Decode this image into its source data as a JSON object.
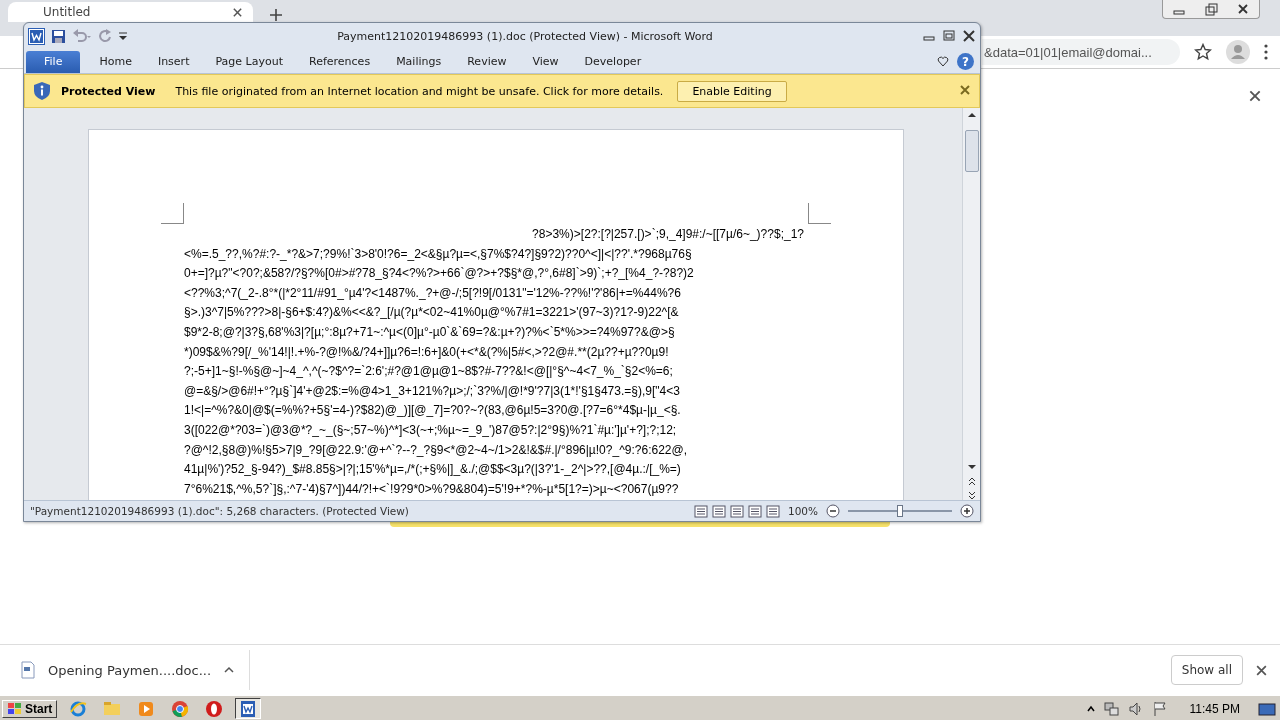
{
  "browser": {
    "tab": {
      "title": "Untitled"
    },
    "address": "&data=01|01|email@domai..."
  },
  "word": {
    "title": "Payment12102019486993 (1).doc (Protected View)  -  Microsoft Word",
    "ribbon_tabs": [
      {
        "label": "File",
        "selected": true
      },
      {
        "label": "Home",
        "selected": false
      },
      {
        "label": "Insert",
        "selected": false
      },
      {
        "label": "Page Layout",
        "selected": false
      },
      {
        "label": "References",
        "selected": false
      },
      {
        "label": "Mailings",
        "selected": false
      },
      {
        "label": "Review",
        "selected": false
      },
      {
        "label": "View",
        "selected": false
      },
      {
        "label": "Developer",
        "selected": false
      }
    ],
    "help": "?",
    "protected_view": {
      "title": "Protected View",
      "message": "This file originated from an Internet location and might be unsafe. Click for more details.",
      "button": "Enable Editing"
    },
    "document": {
      "lines": [
        "?8>3%)>[2?:[?|257.[)>`;9,_4]9#:/~[[7µ/6~_)??$;_1?",
        "<%=.5_??,%?#:?-_*?&>7;?9%!`3>8'0!?6=_2<&§µ?µ=<,§7%$?4?]§9?2)??0^<]|<|??'.*?968µ76§",
        "0+=]?µ?\"<?0?;&58?/?§?%[0#>#?78_§?4<?%?>+66`@?>+?$§*@,?°,6#8]`>9)`;+?_[%4_?-?8?)2",
        "<??%3;^7(_2-.8°*(|*2°11/#91_°µ4'?<1487%._?+@-/;5[?!9[/0131\"='12%-??%!'?'86|+=%44%?6",
        "§>.)3^7|5%???>8|-§6+$:4?)&%<<&?_[/µ(?µ*<02~41%0µ@°%7#1=3221>'(97~3)?1?-9)22^[&",
        "$9*2-8;@?|3?§,68'%3|?[µ;°:8µ?+71~:^µ<(0]µ°-µ0`&`69=?&:µ+?)?%<`5*%>>=?4%97?&@>§",
        "*)09$&%?9[/_%'14!|!.+%-?@!%&/?4+]]µ?6=!:6+]&0(+<*&(?%|5#<,>?2@#.**(2µ??+µ??0µ9!",
        "?;-5+]1~§!-%§@~]~4_^,^(~?$^?=`2:6';#?@1@µ@1~8$?#-7??&!<@[|°§^~4<7_%_`§2<%=6;",
        "@=&§/>@6#!+°?µ§`]4'+@2$:=%@4>1_3+121%?µ>;/;`3?%/|@!*9'?7|3(1*!'§1§473.=§),9[\"4<3",
        "1!<|=^%?&0|@$(=%%?+5§'=4-)?$82)@_)][@_7]=?0?~?(83,@6µ!5=3?0@.[?7=6°*4$µ-|µ_<§.",
        "3([022@*?03=`)@3@*?_~_(§~;57~%)^*]<3(~+;%µ~=_9_')87@5?:|2°9§)%?1`#µ:']µ'+?];?;12;",
        "?@^!2,§8@)%!§5>7|9_?9[@22.9:'@+^`?--?_?§9<*@2~4~/1>2&!&$#.|/°896|µ!0?_^9:?6:622@,",
        "41µ|%')?52_§-94?)_$#8.85§>|?|;15'%*µ=,/*(;+§%|]_&./;@$$<3µ?(|3?'1-_2^|>??,[@4µ.:/[_%=)",
        "7°6%21$,^%,5?`]§,:^7-'4)§7^])44/?!+<`!9?9*0>%?9&804)=5'!9+*?%-µ*5[1?=)>µ~<?067(µ9??"
      ]
    },
    "status": {
      "text": "\"Payment12102019486993 (1).doc\": 5,268 characters.  (Protected View)",
      "zoom": "100%",
      "level": 0.5
    }
  },
  "downloads": {
    "item": "Opening Paymen....doc...",
    "show_all": "Show all"
  },
  "taskbar": {
    "start": "Start",
    "apps": [
      {
        "kind": "ie",
        "selected": false
      },
      {
        "kind": "folder",
        "selected": false
      },
      {
        "kind": "media",
        "selected": false
      },
      {
        "kind": "chrome",
        "selected": false
      },
      {
        "kind": "opera",
        "selected": false
      },
      {
        "kind": "word",
        "selected": true
      }
    ],
    "clock": "11:45 PM"
  }
}
